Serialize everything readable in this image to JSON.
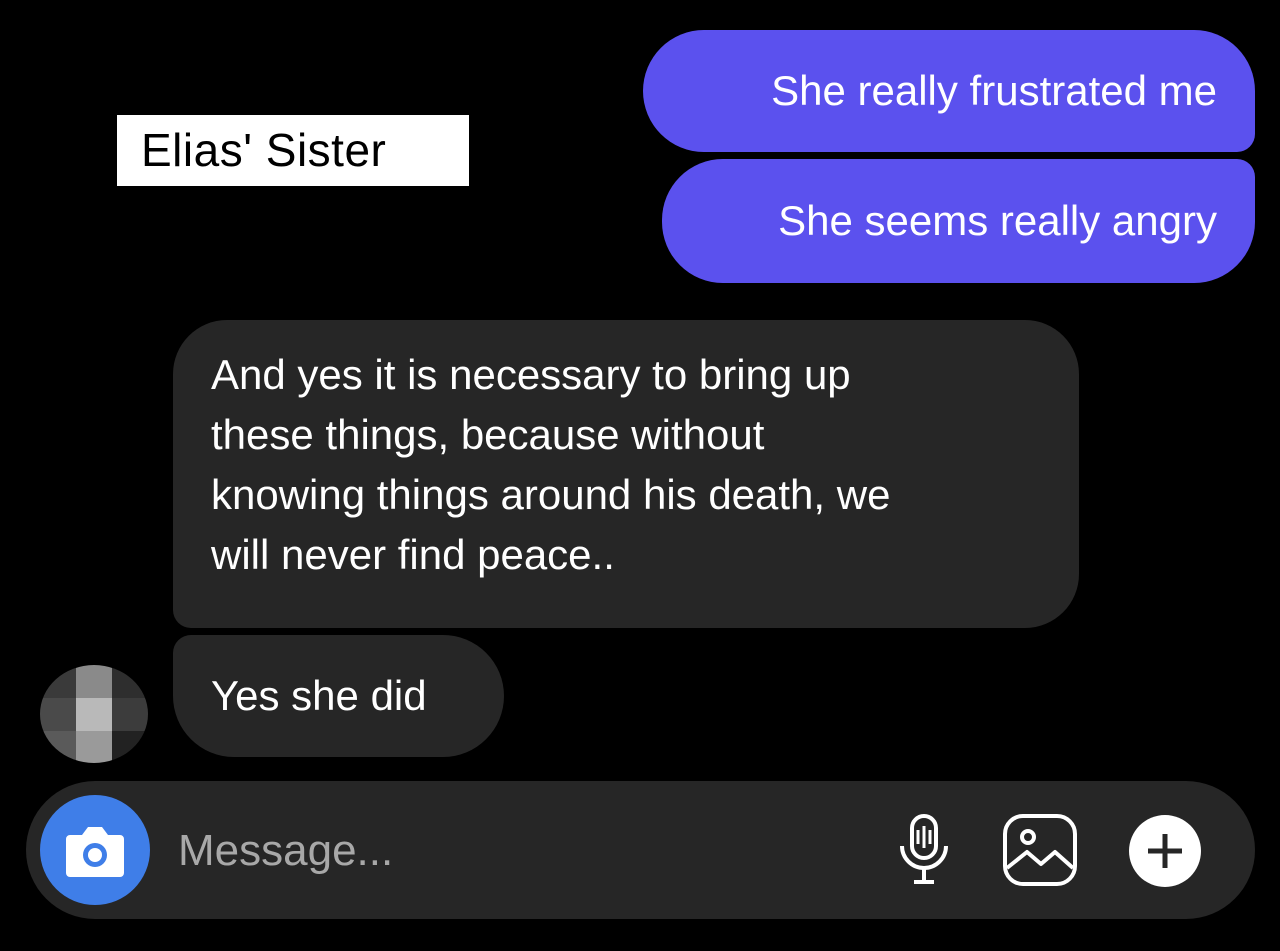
{
  "overlay_label": "Elias' Sister",
  "messages": {
    "sent": [
      {
        "text": "She really frustrated me"
      },
      {
        "text": "She seems really angry"
      }
    ],
    "received": [
      {
        "lines": [
          "And yes it is necessary to bring up",
          "these things, because without",
          "knowing things around his death, we",
          "will never find peace.."
        ]
      },
      {
        "text": "Yes she did"
      }
    ]
  },
  "composer": {
    "placeholder": "Message...",
    "icons": [
      "camera-icon",
      "microphone-icon",
      "gallery-icon",
      "plus-icon"
    ]
  },
  "colors": {
    "background": "#000000",
    "sent_bubble": "#5b51ee",
    "received_bubble": "#262626",
    "composer_bg": "#262626",
    "camera_button": "#3f7ee8",
    "placeholder_text": "#a8a8a8"
  }
}
